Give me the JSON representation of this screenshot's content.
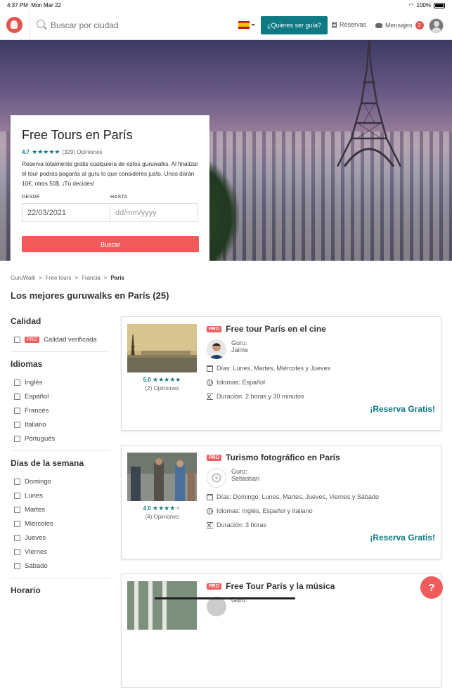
{
  "status": {
    "time": "4:37 PM",
    "date": "Mon Mar 22",
    "battery": "100%"
  },
  "nav": {
    "search_placeholder": "Buscar por ciudad",
    "guide_button": "¿Quieres ser guía?",
    "reservas": "Reservas",
    "mensajes": "Mensajes",
    "mensajes_count": "2"
  },
  "hero": {
    "title": "Free Tours en París",
    "rating": "4.7",
    "stars": "★★★★★",
    "reviews": "(329) Opiniones",
    "description": "Reserva totalmente gratis cualquiera de estos guruwalks. Al finalizar el tour podrás pagarás al guru lo que consideres justo. Unos darán 10€, otros 50$. ¡Tú decides!",
    "from_label": "DESDE",
    "from_value": "22/03/2021",
    "to_label": "HASTA",
    "to_placeholder": "dd/mm/yyyy",
    "search_button": "Buscar"
  },
  "breadcrumb": [
    "GuruWalk",
    ">",
    "Free tours",
    ">",
    "Francia",
    ">",
    "París"
  ],
  "heading": "Los mejores guruwalks en París (25)",
  "filters": [
    {
      "title": "Calidad",
      "items": [
        {
          "label": "Calidad verificada",
          "pro": "PRO"
        }
      ]
    },
    {
      "title": "Idiomas",
      "items": [
        {
          "label": "Inglés"
        },
        {
          "label": "Español"
        },
        {
          "label": "Francés"
        },
        {
          "label": "Italiano"
        },
        {
          "label": "Portugués"
        }
      ]
    },
    {
      "title": "Días de la semana",
      "items": [
        {
          "label": "Domingo"
        },
        {
          "label": "Lunes"
        },
        {
          "label": "Martes"
        },
        {
          "label": "Miércoles"
        },
        {
          "label": "Jueves"
        },
        {
          "label": "Viernes"
        },
        {
          "label": "Sábado"
        }
      ]
    },
    {
      "title": "Horario",
      "items": []
    }
  ],
  "tours": [
    {
      "pro": "PRO",
      "title": "Free tour París en el cine",
      "guru_label": "Guru:",
      "guru": "Jaime",
      "days": "Días: Lunes, Martes, Miércoles y Jueves",
      "languages": "Idiomas: Español",
      "duration": "Duración: 2 horas y 30 minutos",
      "rating": "5.0",
      "stars": "★★★★★",
      "reviews": "(2) Opiniones",
      "cta": "¡Reserva Gratis!"
    },
    {
      "pro": "PRO",
      "title": "Turismo fotográfico en París",
      "guru_label": "Guru:",
      "guru": "Sebastian",
      "days": "Días: Domingo, Lunes, Martes, Jueves, Viernes y Sábado",
      "languages": "Idiomas: Inglés, Español y Italiano",
      "duration": "Duración: 3 horas",
      "rating": "4.0",
      "stars": "★★★★",
      "stars_empty": "★",
      "reviews": "(4) Opiniones",
      "cta": "¡Reserva Gratis!"
    },
    {
      "pro": "PRO",
      "title": "Free Tour París y la música",
      "guru_label": "Guru:"
    }
  ],
  "help": "?"
}
